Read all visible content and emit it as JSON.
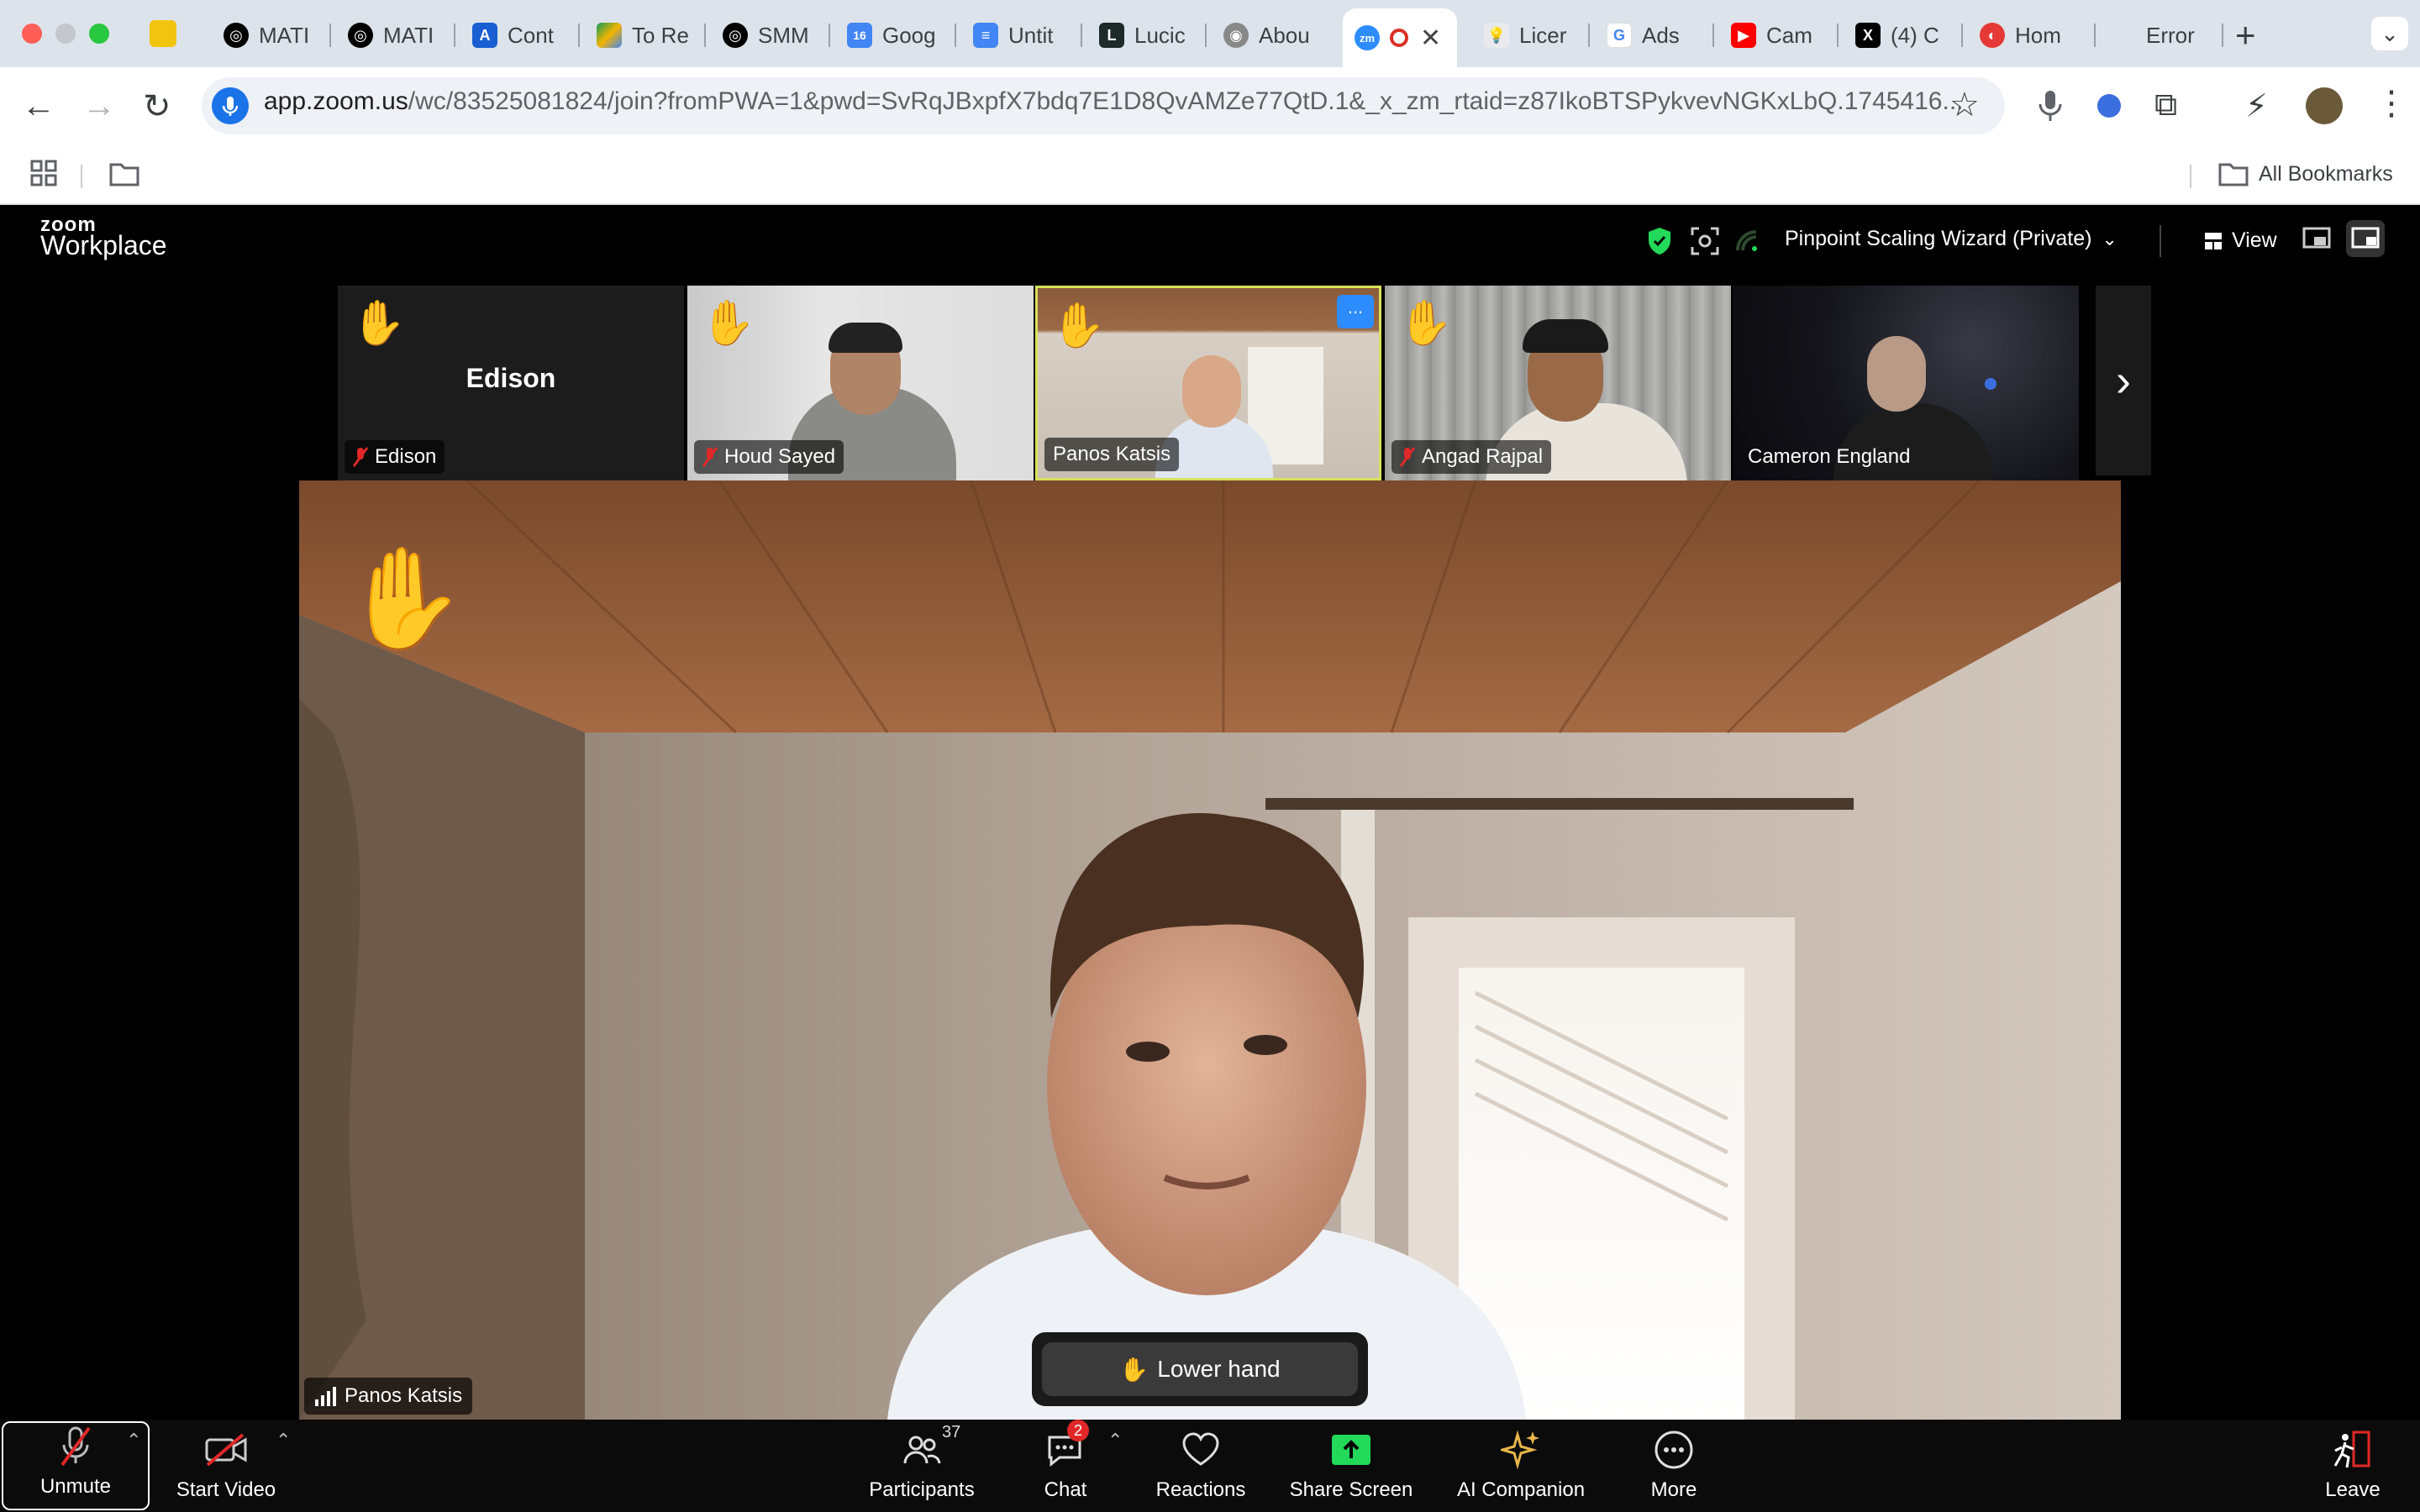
{
  "browser": {
    "tabs": [
      {
        "label": "MATI",
        "icon": "openai-icon"
      },
      {
        "label": "MATI",
        "icon": "openai-icon"
      },
      {
        "label": "Cont",
        "icon": "apollo-icon"
      },
      {
        "label": "To Re",
        "icon": "drive-icon"
      },
      {
        "label": "SMM",
        "icon": "openai-icon"
      },
      {
        "label": "Goog",
        "icon": "calendar-icon"
      },
      {
        "label": "Untit",
        "icon": "docs-icon"
      },
      {
        "label": "Lucic",
        "icon": "lucid-icon"
      },
      {
        "label": "Abou",
        "icon": "eye-icon"
      },
      {
        "label": "",
        "icon": "zoom-icon",
        "active": true
      },
      {
        "label": "Licer",
        "icon": "bulb-icon"
      },
      {
        "label": "Ads",
        "icon": "google-icon"
      },
      {
        "label": "Cam",
        "icon": "youtube-icon"
      },
      {
        "label": "(4) C",
        "icon": "x-icon"
      },
      {
        "label": "Hom",
        "icon": "home-icon"
      },
      {
        "label": "Error",
        "icon": ""
      }
    ],
    "calendar_badge": "16",
    "url_host": "app.zoom.us",
    "url_rest": "/wc/83525081824/join?fromPWA=1&pwd=SvRqJBxpfX7bdq7E1D8QvAMZe77QtD.1&_x_zm_rtaid=z87IkoBTSPykvevNGKxLbQ.1745416...",
    "bookmarks_label": "All Bookmarks"
  },
  "zoom": {
    "brand_small": "zoom",
    "brand_big": "Workplace",
    "meeting_name": "Pinpoint Scaling Wizard (Private)",
    "view_label": "View",
    "next_label": "›",
    "participants": [
      {
        "name": "Edison",
        "display": "Edison",
        "muted": true,
        "hand": true,
        "video": false
      },
      {
        "name": "Houd Sayed",
        "muted": true,
        "hand": true,
        "video": true
      },
      {
        "name": "Panos Katsis",
        "muted": false,
        "hand": true,
        "video": true,
        "active": true
      },
      {
        "name": "Angad Rajpal",
        "muted": true,
        "hand": true,
        "video": true
      },
      {
        "name": "Cameron England",
        "muted": false,
        "hand": false,
        "video": true
      }
    ],
    "main_speaker": "Panos Katsis",
    "lower_hand_label": "Lower hand",
    "controls": {
      "unmute": "Unmute",
      "start_video": "Start Video",
      "participants": "Participants",
      "participants_count": "37",
      "chat": "Chat",
      "chat_badge": "2",
      "reactions": "Reactions",
      "share_screen": "Share Screen",
      "ai_companion": "AI Companion",
      "more": "More",
      "leave": "Leave"
    },
    "thumb_more": "..."
  },
  "colors": {
    "accent_blue": "#2d8cff",
    "share_green": "#23d959",
    "leave_red": "#e02828",
    "active_border": "#d6e25a"
  }
}
